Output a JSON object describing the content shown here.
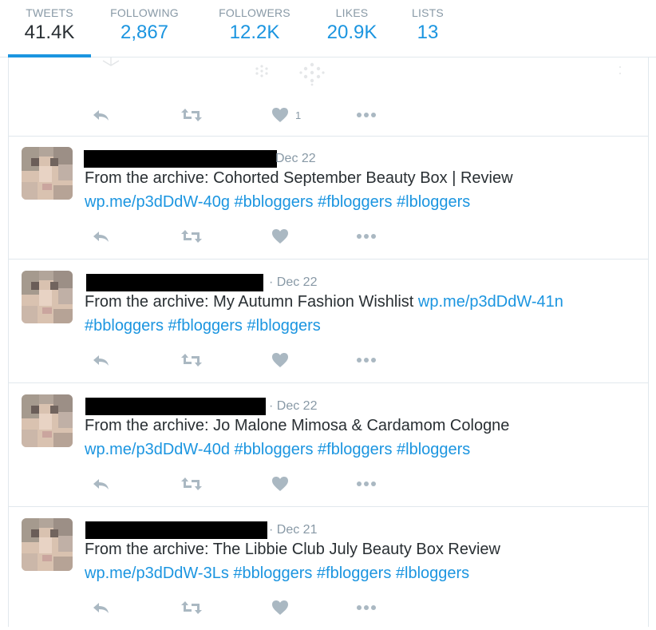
{
  "stats": [
    {
      "label": "TWEETS",
      "value": "41.4K",
      "active": true
    },
    {
      "label": "FOLLOWING",
      "value": "2,867"
    },
    {
      "label": "FOLLOWERS",
      "value": "12.2K"
    },
    {
      "label": "LIKES",
      "value": "20.9K"
    },
    {
      "label": "LISTS",
      "value": "13"
    }
  ],
  "first_tweet": {
    "like_count": "1"
  },
  "tweets": [
    {
      "time": "Dec 22",
      "text": "From the archive: Cohorted September Beauty Box | Review",
      "link": "wp.me/p3dDdW-40g",
      "hashtags": [
        "#bbloggers",
        "#fbloggers",
        "#lbloggers"
      ]
    },
    {
      "time": "Dec 22",
      "text": "From the archive: My Autumn Fashion Wishlist",
      "link": "wp.me/p3dDdW-41n",
      "hashtags": [
        "#bbloggers",
        "#fbloggers",
        "#lbloggers"
      ]
    },
    {
      "time": "Dec 22",
      "text": "From the archive: Jo Malone Mimosa & Cardamom Cologne",
      "link": "wp.me/p3dDdW-40d",
      "hashtags": [
        "#bbloggers",
        "#fbloggers",
        "#lbloggers"
      ]
    },
    {
      "time": "Dec 21",
      "text": "From the archive: The Libbie Club July Beauty Box Review",
      "link": "wp.me/p3dDdW-3Ls",
      "hashtags": [
        "#bbloggers",
        "#fbloggers",
        "#lbloggers"
      ]
    }
  ],
  "icons": {
    "reply": "reply-icon",
    "retweet": "retweet-icon",
    "like": "heart-icon",
    "more": "more-icon"
  },
  "colors": {
    "link": "#1b95e0",
    "text": "#292f33",
    "muted": "#8899a6",
    "icon": "#aab8c2",
    "border": "#e1e8ed"
  }
}
